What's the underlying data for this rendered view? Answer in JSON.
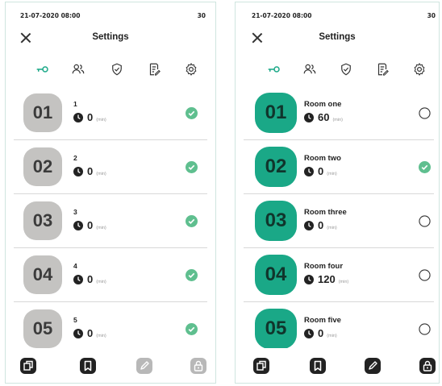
{
  "colors": {
    "accent": "#1aa887",
    "disabled": "#c4c3c1",
    "check": "#5fbf8f"
  },
  "screens": [
    {
      "status": {
        "datetime": "21-07-2020 08:00",
        "battery": "30"
      },
      "title": "Settings",
      "tabs": [
        {
          "icon": "key-icon",
          "active": true
        },
        {
          "icon": "users-icon",
          "active": false
        },
        {
          "icon": "shield-check-icon",
          "active": false
        },
        {
          "icon": "notes-edit-icon",
          "active": false
        },
        {
          "icon": "gear-icon",
          "active": false
        }
      ],
      "rooms": [
        {
          "number": "01",
          "name": "1",
          "time": "0",
          "unit": "(min)",
          "selected": true
        },
        {
          "number": "02",
          "name": "2",
          "time": "0",
          "unit": "(min)",
          "selected": true
        },
        {
          "number": "03",
          "name": "3",
          "time": "0",
          "unit": "(min)",
          "selected": true
        },
        {
          "number": "04",
          "name": "4",
          "time": "0",
          "unit": "(min)",
          "selected": true
        },
        {
          "number": "05",
          "name": "5",
          "time": "0",
          "unit": "(min)",
          "selected": true
        }
      ],
      "bottom": [
        "copy-icon",
        "bookmark-icon",
        "pencil-icon",
        "lock-icon"
      ]
    },
    {
      "status": {
        "datetime": "21-07-2020 08:00",
        "battery": "30"
      },
      "title": "Settings",
      "tabs": [
        {
          "icon": "key-icon",
          "active": true
        },
        {
          "icon": "users-icon",
          "active": false
        },
        {
          "icon": "shield-check-icon",
          "active": false
        },
        {
          "icon": "notes-edit-icon",
          "active": false
        },
        {
          "icon": "gear-icon",
          "active": false
        }
      ],
      "rooms": [
        {
          "number": "01",
          "name": "Room one",
          "time": "60",
          "unit": "(min)",
          "selected": false
        },
        {
          "number": "02",
          "name": "Room two",
          "time": "0",
          "unit": "(min)",
          "selected": true
        },
        {
          "number": "03",
          "name": "Room three",
          "time": "0",
          "unit": "(min)",
          "selected": false
        },
        {
          "number": "04",
          "name": "Room four",
          "time": "120",
          "unit": "(min)",
          "selected": false
        },
        {
          "number": "05",
          "name": "Room five",
          "time": "0",
          "unit": "(min)",
          "selected": false
        }
      ],
      "bottom": [
        "copy-icon",
        "bookmark-icon",
        "pencil-icon",
        "lock-icon"
      ]
    }
  ]
}
